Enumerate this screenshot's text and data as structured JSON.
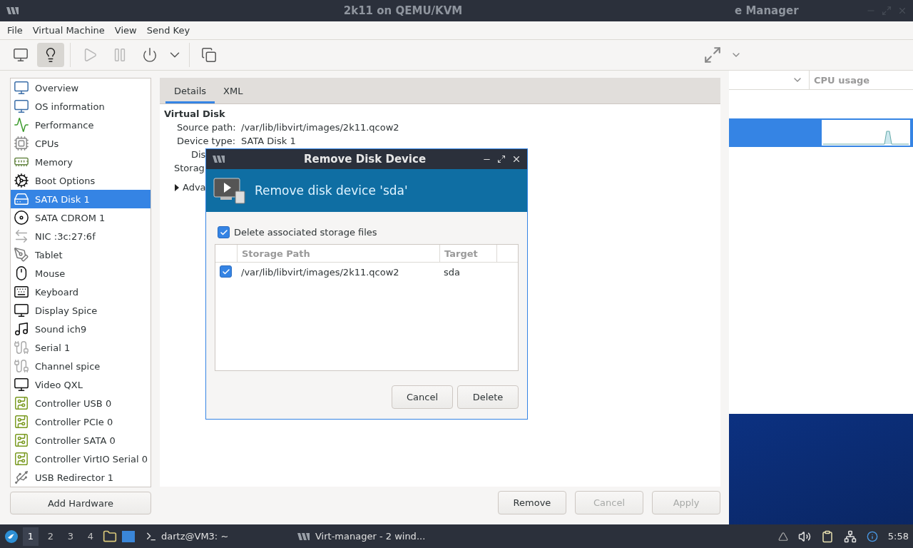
{
  "back_window": {
    "title": "e Manager",
    "columns": [
      "CPU usage"
    ],
    "rows": [
      {
        "kind": "connection",
        "selected": false
      },
      {
        "kind": "vm",
        "selected": true
      }
    ]
  },
  "main_window": {
    "title": "2k11 on QEMU/KVM",
    "menu": [
      "File",
      "Virtual Machine",
      "View",
      "Send Key"
    ],
    "toolbar": [
      {
        "kind": "console",
        "selected": false,
        "disabled": false
      },
      {
        "kind": "details",
        "selected": true,
        "disabled": false
      },
      {
        "kind": "run",
        "selected": false,
        "disabled": true
      },
      {
        "kind": "pause",
        "selected": false,
        "disabled": true
      },
      {
        "kind": "power",
        "selected": false,
        "disabled": false
      },
      {
        "kind": "caret",
        "selected": false,
        "disabled": false
      },
      {
        "kind": "snapshots",
        "selected": false,
        "disabled": false
      }
    ],
    "sidebar": {
      "items": [
        {
          "label": "Overview",
          "kind": "monitor",
          "selected": false
        },
        {
          "label": "OS information",
          "kind": "monitor",
          "selected": false
        },
        {
          "label": "Performance",
          "kind": "performance",
          "selected": false
        },
        {
          "label": "CPUs",
          "kind": "cpu",
          "selected": false
        },
        {
          "label": "Memory",
          "kind": "memory",
          "selected": false
        },
        {
          "label": "Boot Options",
          "kind": "boot",
          "selected": false
        },
        {
          "label": "SATA Disk 1",
          "kind": "disk",
          "selected": true
        },
        {
          "label": "SATA CDROM 1",
          "kind": "cdrom",
          "selected": false
        },
        {
          "label": "NIC :3c:27:6f",
          "kind": "nic",
          "selected": false
        },
        {
          "label": "Tablet",
          "kind": "tablet",
          "selected": false
        },
        {
          "label": "Mouse",
          "kind": "mouse",
          "selected": false
        },
        {
          "label": "Keyboard",
          "kind": "keyboard",
          "selected": false
        },
        {
          "label": "Display Spice",
          "kind": "display",
          "selected": false
        },
        {
          "label": "Sound ich9",
          "kind": "sound",
          "selected": false
        },
        {
          "label": "Serial 1",
          "kind": "serial",
          "selected": false
        },
        {
          "label": "Channel spice",
          "kind": "serial",
          "selected": false
        },
        {
          "label": "Video QXL",
          "kind": "display",
          "selected": false
        },
        {
          "label": "Controller USB 0",
          "kind": "controller",
          "selected": false
        },
        {
          "label": "Controller PCIe 0",
          "kind": "controller",
          "selected": false
        },
        {
          "label": "Controller SATA 0",
          "kind": "controller",
          "selected": false
        },
        {
          "label": "Controller VirtIO Serial 0",
          "kind": "controller",
          "selected": false
        },
        {
          "label": "USB Redirector 1",
          "kind": "usb",
          "selected": false
        }
      ],
      "add_button": "Add Hardware"
    },
    "tabs": [
      {
        "label": "Details",
        "selected": true
      },
      {
        "label": "XML",
        "selected": false
      }
    ],
    "details": {
      "section": "Virtual Disk",
      "fields": [
        {
          "label": "Source path:",
          "value": "/var/lib/libvirt/images/2k11.qcow2"
        },
        {
          "label": "Device type:",
          "value": "SATA Disk 1"
        },
        {
          "label": "Dis"
        },
        {
          "label": "Storag"
        }
      ],
      "expander": {
        "label": "Adva",
        "expanded": false
      }
    },
    "buttons": [
      {
        "label": "Remove",
        "disabled": false
      },
      {
        "label": "Cancel",
        "disabled": true
      },
      {
        "label": "Apply",
        "disabled": true
      }
    ]
  },
  "dialog": {
    "title": "Remove Disk Device",
    "heading": "Remove disk device 'sda'",
    "checkbox": {
      "label": "Delete associated storage files",
      "checked": true
    },
    "columns": [
      "Storage Path",
      "Target"
    ],
    "rows": [
      {
        "checked": true,
        "path": "/var/lib/libvirt/images/2k11.qcow2",
        "target": "sda"
      }
    ],
    "buttons": [
      "Cancel",
      "Delete"
    ]
  },
  "taskbar": {
    "workspaces": [
      {
        "label": "1",
        "selected": true
      },
      {
        "label": "2",
        "selected": false
      },
      {
        "label": "3",
        "selected": false
      },
      {
        "label": "4",
        "selected": false
      }
    ],
    "tasks": [
      {
        "kind": "terminal",
        "label": "dartz@VM3: ~"
      },
      {
        "kind": "virt",
        "label": "Virt-manager - 2 wind..."
      }
    ],
    "clock": "5:58"
  }
}
